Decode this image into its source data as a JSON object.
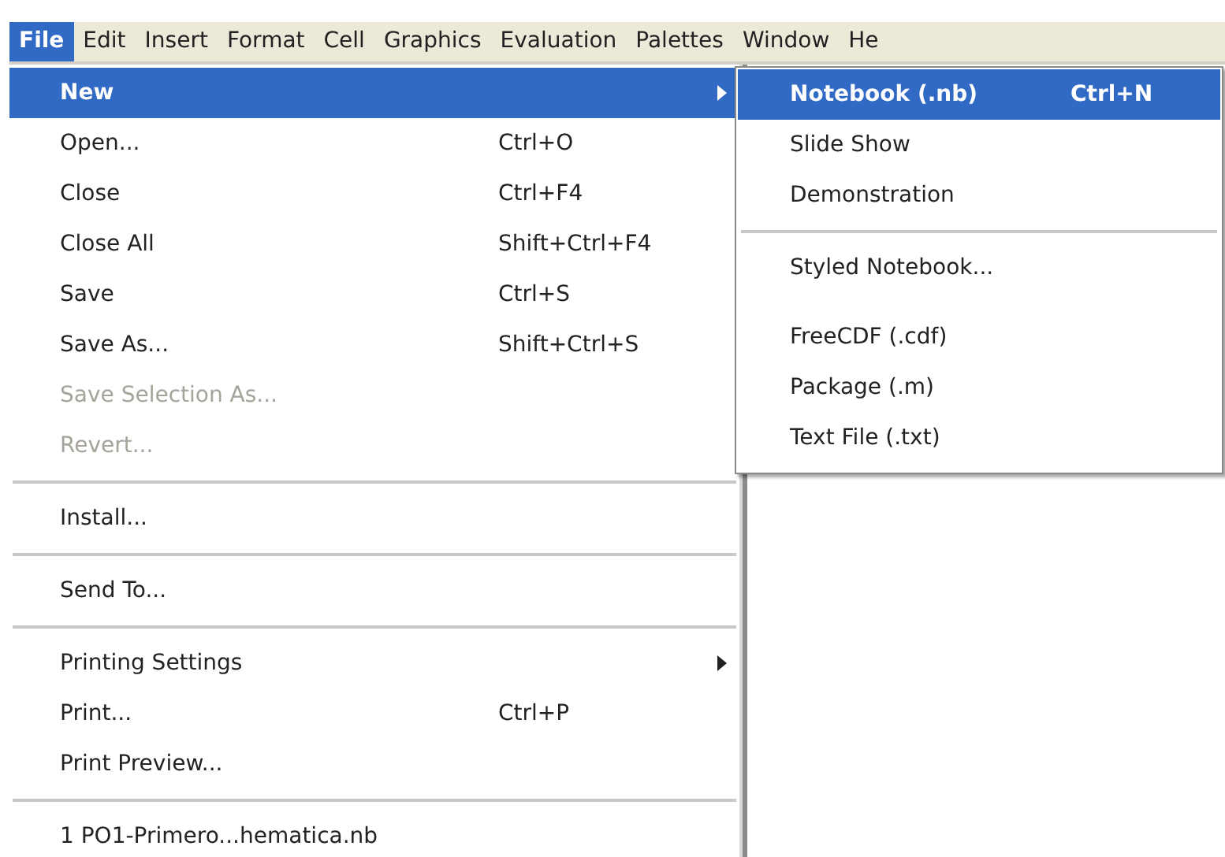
{
  "menubar": [
    {
      "label": "File",
      "selected": true
    },
    {
      "label": "Edit",
      "selected": false
    },
    {
      "label": "Insert",
      "selected": false
    },
    {
      "label": "Format",
      "selected": false
    },
    {
      "label": "Cell",
      "selected": false
    },
    {
      "label": "Graphics",
      "selected": false
    },
    {
      "label": "Evaluation",
      "selected": false
    },
    {
      "label": "Palettes",
      "selected": false
    },
    {
      "label": "Window",
      "selected": false
    },
    {
      "label": "He",
      "selected": false
    }
  ],
  "file_menu": [
    {
      "kind": "item",
      "label": "New",
      "selected": true,
      "disabled": false,
      "submenu": true
    },
    {
      "kind": "item",
      "label": "Open...",
      "shortcut": "Ctrl+O",
      "selected": false,
      "disabled": false,
      "submenu": false
    },
    {
      "kind": "item",
      "label": "Close",
      "shortcut": "Ctrl+F4",
      "selected": false,
      "disabled": false,
      "submenu": false
    },
    {
      "kind": "item",
      "label": "Close All",
      "shortcut": "Shift+Ctrl+F4",
      "selected": false,
      "disabled": false,
      "submenu": false
    },
    {
      "kind": "item",
      "label": "Save",
      "shortcut": "Ctrl+S",
      "selected": false,
      "disabled": false,
      "submenu": false
    },
    {
      "kind": "item",
      "label": "Save As...",
      "shortcut": "Shift+Ctrl+S",
      "selected": false,
      "disabled": false,
      "submenu": false
    },
    {
      "kind": "item",
      "label": "Save Selection As...",
      "selected": false,
      "disabled": true,
      "submenu": false
    },
    {
      "kind": "item",
      "label": "Revert...",
      "selected": false,
      "disabled": true,
      "submenu": false
    },
    {
      "kind": "separator"
    },
    {
      "kind": "item",
      "label": "Install...",
      "selected": false,
      "disabled": false,
      "submenu": false
    },
    {
      "kind": "separator"
    },
    {
      "kind": "item",
      "label": "Send To...",
      "selected": false,
      "disabled": false,
      "submenu": false
    },
    {
      "kind": "separator"
    },
    {
      "kind": "item",
      "label": "Printing Settings",
      "selected": false,
      "disabled": false,
      "submenu": true
    },
    {
      "kind": "item",
      "label": "Print...",
      "shortcut": "Ctrl+P",
      "selected": false,
      "disabled": false,
      "submenu": false
    },
    {
      "kind": "item",
      "label": "Print Preview...",
      "selected": false,
      "disabled": false,
      "submenu": false
    },
    {
      "kind": "separator"
    },
    {
      "kind": "item",
      "label": "1 PO1-Primero...hematica.nb",
      "selected": false,
      "disabled": false,
      "submenu": false
    }
  ],
  "new_submenu": [
    {
      "kind": "item",
      "label": "Notebook (.nb)",
      "shortcut": "Ctrl+N",
      "selected": true
    },
    {
      "kind": "item",
      "label": "Slide Show",
      "selected": false
    },
    {
      "kind": "item",
      "label": "Demonstration",
      "selected": false
    },
    {
      "kind": "separator"
    },
    {
      "kind": "item",
      "label": "Styled Notebook...",
      "selected": false
    },
    {
      "kind": "gap"
    },
    {
      "kind": "item",
      "label": "FreeCDF (.cdf)",
      "selected": false
    },
    {
      "kind": "item",
      "label": "Package (.m)",
      "selected": false
    },
    {
      "kind": "item",
      "label": "Text File (.txt)",
      "selected": false
    }
  ]
}
